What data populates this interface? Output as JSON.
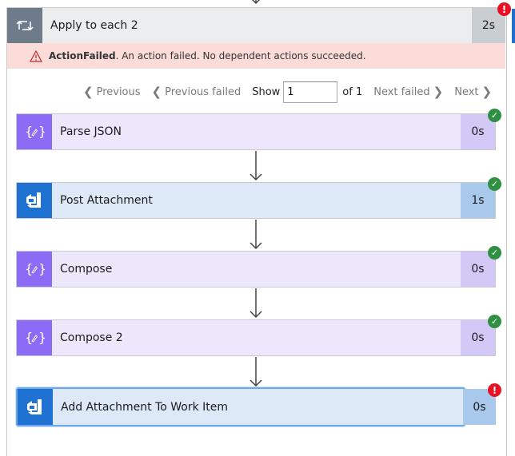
{
  "loop": {
    "title": "Apply to each 2",
    "duration": "2s",
    "status": "failed",
    "icon": "loop-icon"
  },
  "error_banner": {
    "code": "ActionFailed",
    "message": ". An action failed. No dependent actions succeeded.",
    "icon": "warning-icon"
  },
  "pager": {
    "previous": "Previous",
    "previous_failed": "Previous failed",
    "show_label": "Show",
    "current_value": "1",
    "of_label": "of 1",
    "next_failed": "Next failed",
    "next": "Next"
  },
  "actions": [
    {
      "title": "Parse JSON",
      "duration": "0s",
      "status": "succeeded",
      "icon": "data-operation-icon"
    },
    {
      "title": "Post Attachment",
      "duration": "1s",
      "status": "succeeded",
      "icon": "azure-devops-icon"
    },
    {
      "title": "Compose",
      "duration": "0s",
      "status": "succeeded",
      "icon": "data-operation-icon"
    },
    {
      "title": "Compose 2",
      "duration": "0s",
      "status": "succeeded",
      "icon": "data-operation-icon"
    },
    {
      "title": "Add Attachment To Work Item",
      "duration": "0s",
      "status": "failed",
      "icon": "azure-devops-icon"
    }
  ],
  "badges": {
    "ok": "✓",
    "err": "!"
  },
  "colors": {
    "data_operation": "#8c6cf6",
    "azure_devops": "#1f72d2",
    "success": "#2f8f43",
    "failure": "#e81123",
    "error_banner_bg": "#fbdcd9"
  }
}
